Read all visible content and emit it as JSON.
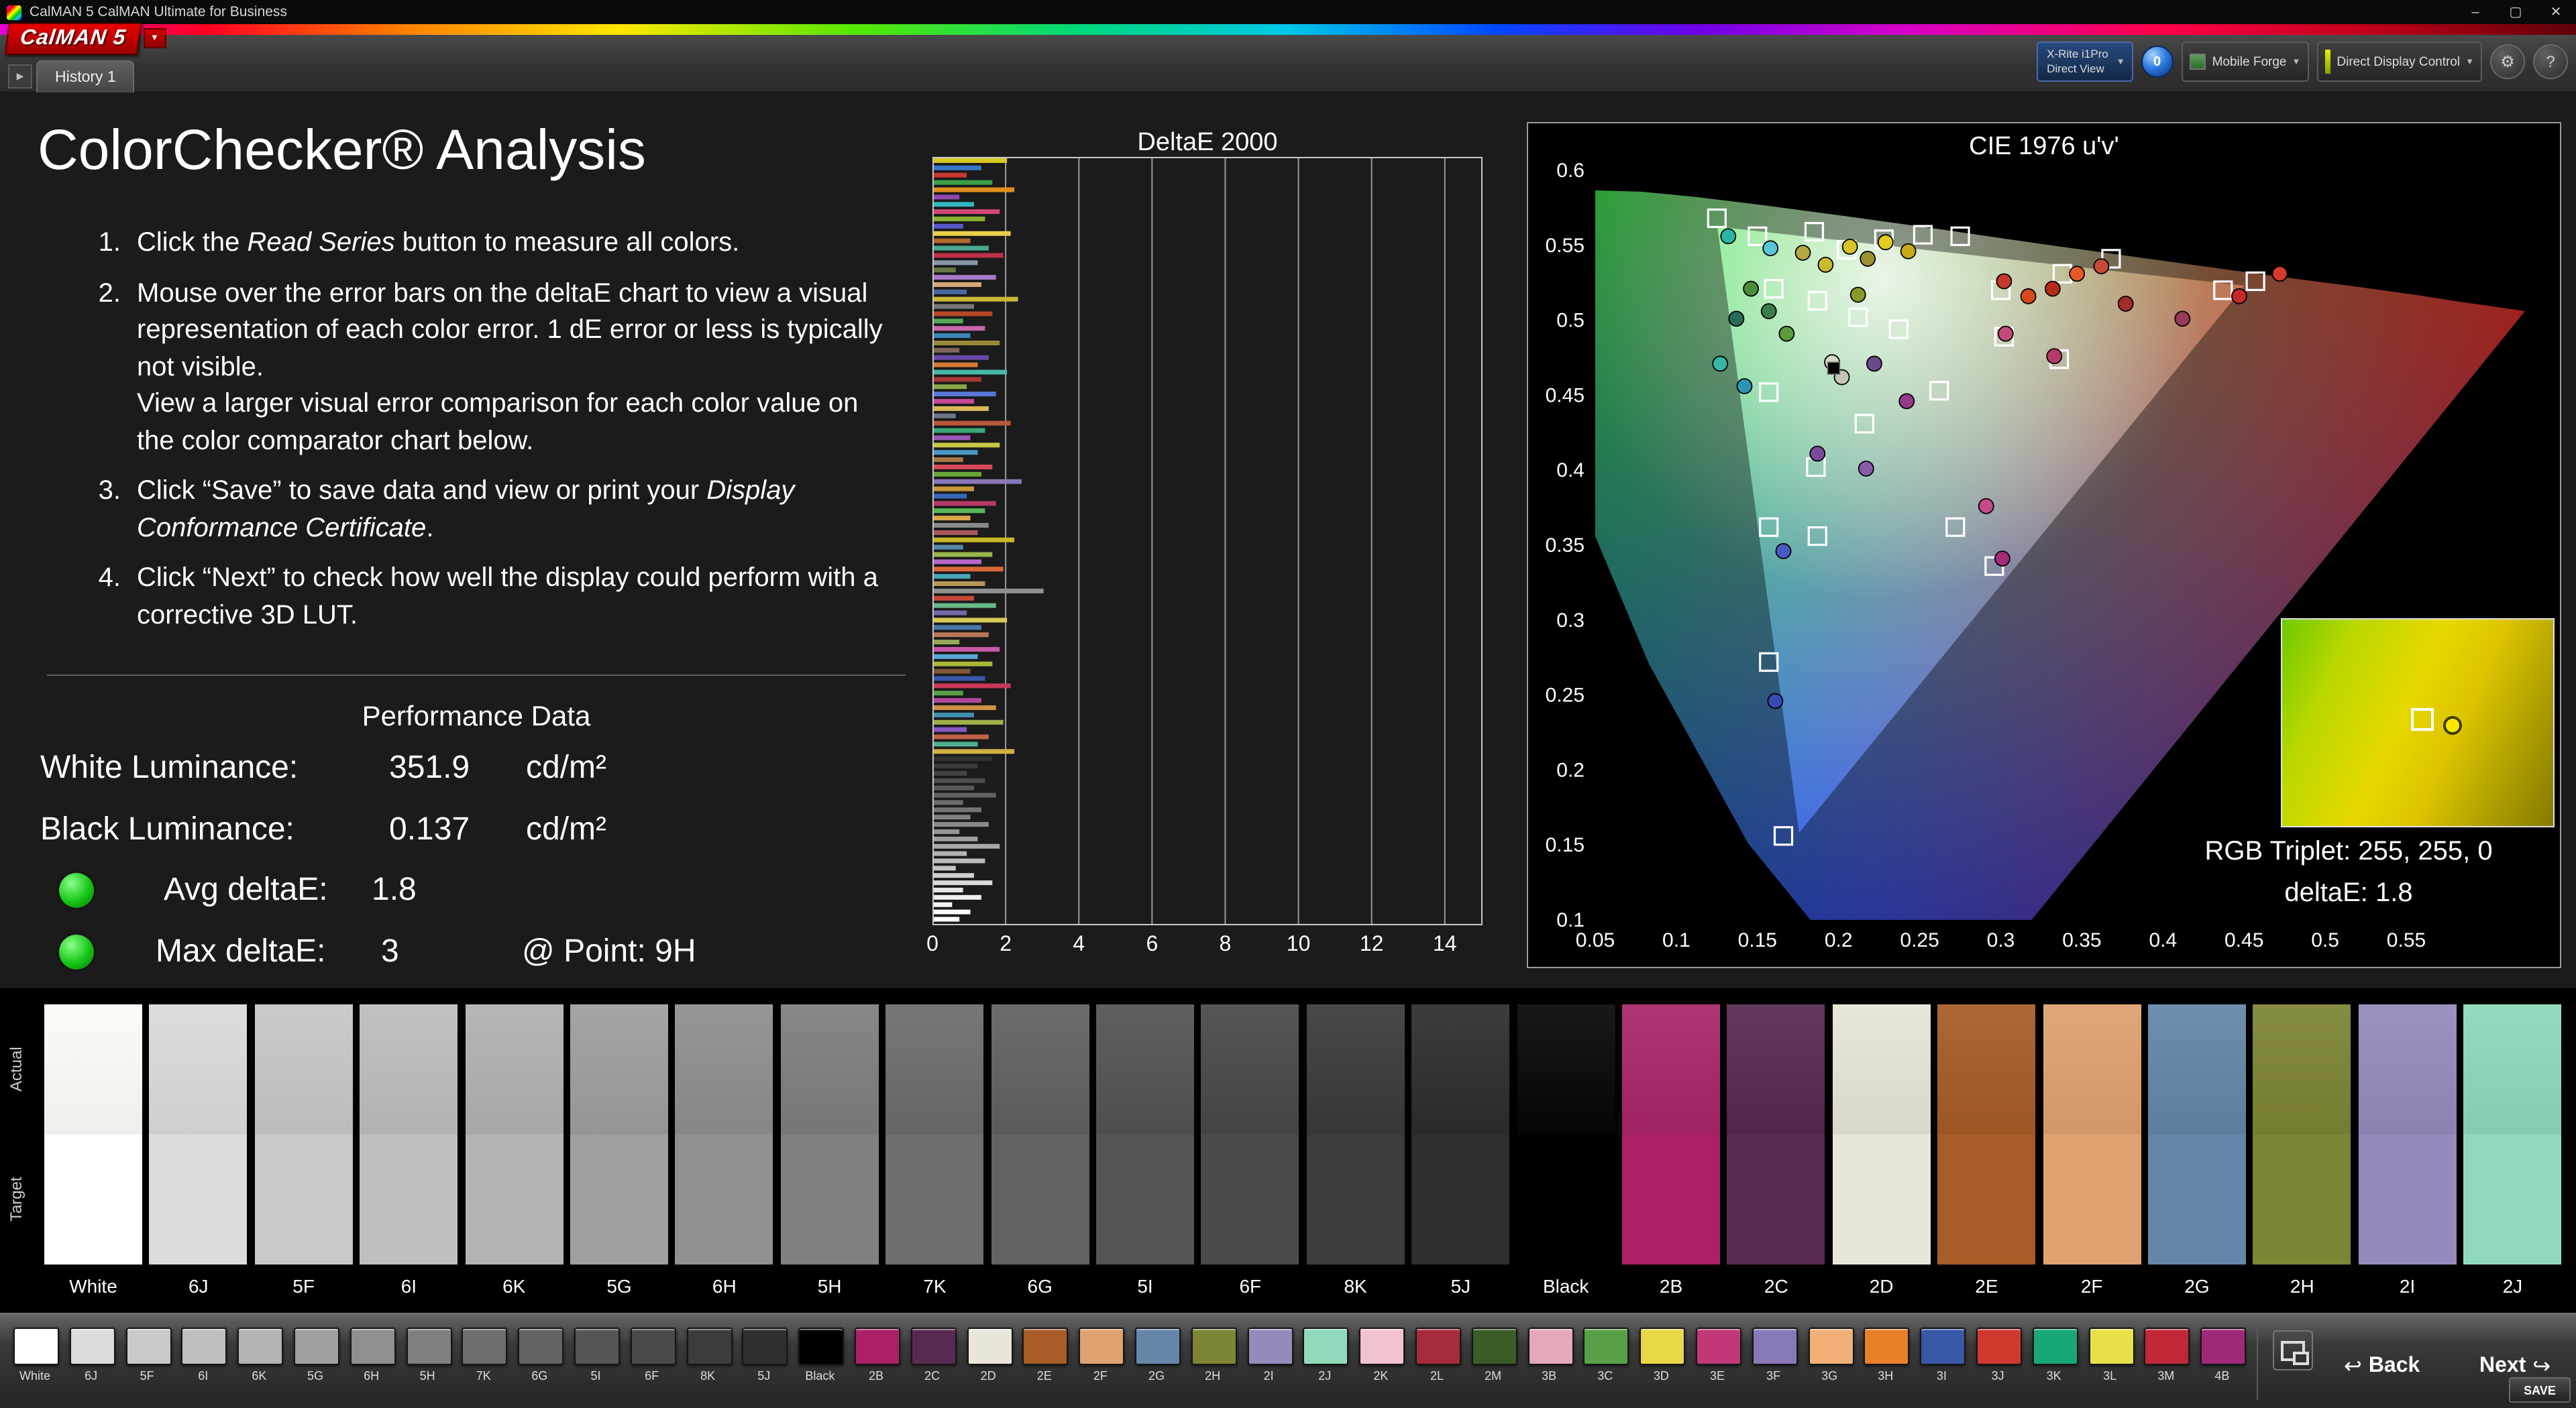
{
  "window": {
    "title": "CalMAN 5 CalMAN Ultimate for Business"
  },
  "icons": {
    "minimize": "–",
    "maximize": "▢",
    "close": "✕",
    "dropdown": "▼",
    "play": "▶",
    "gear": "⚙",
    "help": "?",
    "back": "↩",
    "next": "↪"
  },
  "logo": {
    "text": "CalMAN 5",
    "caret": "▼"
  },
  "tabbar": {
    "history_tab": "History 1"
  },
  "controls": {
    "meter_line1": "X-Rite i1Pro",
    "meter_line2": "Direct View",
    "meter_count": "0",
    "source_label": "Mobile Forge",
    "ddc_label": "Direct Display Control"
  },
  "page": {
    "title": "ColorChecker® Analysis",
    "instructions": [
      {
        "num": "1.",
        "segments": [
          {
            "t": "Click the ",
            "i": false
          },
          {
            "t": "Read Series",
            "i": true
          },
          {
            "t": " button to measure all colors.",
            "i": false
          }
        ]
      },
      {
        "num": "2.",
        "segments": [
          {
            "t": "Mouse over the error bars on the deltaE chart to view a visual representation of each color error. 1 dE error or less is typically not visible.\nView a larger visual error comparison for each color value on the color comparator chart below.",
            "i": false
          }
        ]
      },
      {
        "num": "3.",
        "segments": [
          {
            "t": "Click “Save” to save data and view or print your ",
            "i": false
          },
          {
            "t": "Display Conformance Certificate",
            "i": true
          },
          {
            "t": ".",
            "i": false
          }
        ]
      },
      {
        "num": "4.",
        "segments": [
          {
            "t": "Click “Next” to check how well the display could perform with a corrective 3D LUT.",
            "i": false
          }
        ]
      }
    ]
  },
  "performance": {
    "heading": "Performance Data",
    "rows": [
      {
        "label": "White Luminance:",
        "value": "351.9",
        "unit": "cd/m²",
        "dot": false
      },
      {
        "label": "Black Luminance:",
        "value": "0.137",
        "unit": "cd/m²",
        "dot": false
      },
      {
        "label": "Avg deltaE:",
        "value": "1.8",
        "unit": "",
        "dot": true
      },
      {
        "label": "Max deltaE:",
        "value": "3",
        "unit": "@ Point: 9H",
        "dot": true
      }
    ]
  },
  "chart_data": [
    {
      "type": "bar",
      "title": "DeltaE 2000",
      "orientation": "horizontal",
      "xlabel": "deltaE 2000",
      "xlim": [
        0,
        14
      ],
      "x_ticks": [
        0,
        2,
        4,
        6,
        8,
        10,
        12,
        14
      ],
      "grid": true,
      "bars": [
        [
          2.0,
          "#d8c820"
        ],
        [
          1.3,
          "#3878c8"
        ],
        [
          0.9,
          "#c83830"
        ],
        [
          1.6,
          "#38a048"
        ],
        [
          2.2,
          "#e09020"
        ],
        [
          0.7,
          "#9048b0"
        ],
        [
          1.1,
          "#30b8c0"
        ],
        [
          1.8,
          "#d04878"
        ],
        [
          1.4,
          "#88b030"
        ],
        [
          0.8,
          "#5858c8"
        ],
        [
          2.1,
          "#e8d048"
        ],
        [
          1.0,
          "#b06828"
        ],
        [
          1.5,
          "#48a890"
        ],
        [
          1.9,
          "#c03048"
        ],
        [
          1.2,
          "#8898a8"
        ],
        [
          0.6,
          "#687848"
        ],
        [
          1.7,
          "#a878c8"
        ],
        [
          1.3,
          "#d8a878"
        ],
        [
          0.9,
          "#4868a0"
        ],
        [
          2.3,
          "#c8b838"
        ],
        [
          1.1,
          "#787878"
        ],
        [
          1.6,
          "#b84828"
        ],
        [
          0.8,
          "#58a858"
        ],
        [
          1.4,
          "#c868a8"
        ],
        [
          1.0,
          "#3888b8"
        ],
        [
          1.8,
          "#988838"
        ],
        [
          0.7,
          "#806858"
        ],
        [
          1.5,
          "#6848a8"
        ],
        [
          1.2,
          "#d87838"
        ],
        [
          2.0,
          "#48b8a8"
        ],
        [
          1.3,
          "#a83838"
        ],
        [
          0.9,
          "#88a848"
        ],
        [
          1.7,
          "#5878d8"
        ],
        [
          1.1,
          "#c84898"
        ],
        [
          1.5,
          "#d8b858"
        ],
        [
          0.6,
          "#687888"
        ],
        [
          2.1,
          "#b85838"
        ],
        [
          1.4,
          "#38a878"
        ],
        [
          1.0,
          "#9858b8"
        ],
        [
          1.8,
          "#c8c848"
        ],
        [
          1.2,
          "#4898c8"
        ],
        [
          0.8,
          "#a87848"
        ],
        [
          1.6,
          "#d84858"
        ],
        [
          1.3,
          "#68a838"
        ],
        [
          2.4,
          "#8878b8"
        ],
        [
          1.1,
          "#c89838"
        ],
        [
          0.9,
          "#3868b8"
        ],
        [
          1.7,
          "#b83868"
        ],
        [
          1.4,
          "#58b858"
        ],
        [
          1.0,
          "#d8a848"
        ],
        [
          1.5,
          "#888888"
        ],
        [
          1.2,
          "#a85858"
        ],
        [
          2.2,
          "#c8b828"
        ],
        [
          0.8,
          "#5888a8"
        ],
        [
          1.6,
          "#98b848"
        ],
        [
          1.3,
          "#b868c8"
        ],
        [
          1.9,
          "#d86838"
        ],
        [
          1.0,
          "#48a8b8"
        ],
        [
          1.4,
          "#b89858"
        ],
        [
          3.0,
          "#909090"
        ],
        [
          1.1,
          "#c84838"
        ],
        [
          1.7,
          "#68b888"
        ],
        [
          0.9,
          "#7868a8"
        ],
        [
          2.0,
          "#d8c858"
        ],
        [
          1.3,
          "#4878a8"
        ],
        [
          1.5,
          "#b87858"
        ],
        [
          0.7,
          "#98a858"
        ],
        [
          1.8,
          "#c858a8"
        ],
        [
          1.2,
          "#58a8d8"
        ],
        [
          1.6,
          "#a8b838"
        ],
        [
          1.0,
          "#805838"
        ],
        [
          1.4,
          "#3858a8"
        ],
        [
          2.1,
          "#c83858"
        ],
        [
          0.8,
          "#58a048"
        ],
        [
          1.3,
          "#b04898"
        ],
        [
          1.7,
          "#d09048"
        ],
        [
          1.1,
          "#4090b0"
        ],
        [
          1.9,
          "#a0b048"
        ],
        [
          0.9,
          "#8858c0"
        ],
        [
          1.5,
          "#c06048"
        ],
        [
          1.2,
          "#50b090"
        ],
        [
          2.2,
          "#d0b040"
        ],
        [
          1.6,
          "#303030"
        ],
        [
          1.2,
          "#3a3a3a"
        ],
        [
          0.9,
          "#444444"
        ],
        [
          1.4,
          "#4e4e4e"
        ],
        [
          1.1,
          "#585858"
        ],
        [
          1.7,
          "#626262"
        ],
        [
          0.8,
          "#6c6c6c"
        ],
        [
          1.3,
          "#767676"
        ],
        [
          1.0,
          "#808080"
        ],
        [
          1.5,
          "#8a8a8a"
        ],
        [
          0.7,
          "#949494"
        ],
        [
          1.2,
          "#9e9e9e"
        ],
        [
          1.8,
          "#a8a8a8"
        ],
        [
          0.9,
          "#b2b2b2"
        ],
        [
          1.4,
          "#bcbcbc"
        ],
        [
          0.6,
          "#c6c6c6"
        ],
        [
          1.1,
          "#d0d0d0"
        ],
        [
          1.6,
          "#dadada"
        ],
        [
          0.8,
          "#e4e4e4"
        ],
        [
          1.3,
          "#eeeeee"
        ],
        [
          0.5,
          "#f4f4f4"
        ],
        [
          1.0,
          "#fafafa"
        ],
        [
          0.7,
          "#ffffff"
        ]
      ]
    },
    {
      "type": "scatter",
      "title": "CIE 1976 u'v'",
      "xlim": [
        0.05,
        0.55
      ],
      "ylim": [
        0.1,
        0.6
      ],
      "x_tick_labels": [
        "0.05",
        "0.1",
        "0.15",
        "0.2",
        "0.25",
        "0.3",
        "0.35",
        "0.4",
        "0.45",
        "0.5",
        "0.55"
      ],
      "y_tick_labels": [
        "0.6",
        "0.55",
        "0.5",
        "0.45",
        "0.4",
        "0.35",
        "0.3",
        "0.25",
        "0.2",
        "0.15",
        "0.1"
      ],
      "target_squares": [
        [
          0.125,
          0.568
        ],
        [
          0.15,
          0.556
        ],
        [
          0.185,
          0.559
        ],
        [
          0.205,
          0.547
        ],
        [
          0.228,
          0.554
        ],
        [
          0.252,
          0.557
        ],
        [
          0.275,
          0.556
        ],
        [
          0.16,
          0.521
        ],
        [
          0.187,
          0.513
        ],
        [
          0.212,
          0.502
        ],
        [
          0.237,
          0.494
        ],
        [
          0.3,
          0.52
        ],
        [
          0.338,
          0.531
        ],
        [
          0.368,
          0.541
        ],
        [
          0.302,
          0.489
        ],
        [
          0.336,
          0.474
        ],
        [
          0.262,
          0.453
        ],
        [
          0.216,
          0.431
        ],
        [
          0.157,
          0.452
        ],
        [
          0.186,
          0.402
        ],
        [
          0.157,
          0.362
        ],
        [
          0.187,
          0.356
        ],
        [
          0.272,
          0.362
        ],
        [
          0.296,
          0.336
        ],
        [
          0.157,
          0.272
        ],
        [
          0.166,
          0.156
        ],
        [
          0.437,
          0.52
        ],
        [
          0.457,
          0.526
        ]
      ],
      "measured_points": [
        [
          0.132,
          0.556,
          "#2ab5a5"
        ],
        [
          0.158,
          0.548,
          "#59c5d5"
        ],
        [
          0.178,
          0.545,
          "#b5a642"
        ],
        [
          0.192,
          0.537,
          "#c9b930"
        ],
        [
          0.207,
          0.549,
          "#d5c32a"
        ],
        [
          0.218,
          0.541,
          "#9b902e"
        ],
        [
          0.229,
          0.552,
          "#e1cd20"
        ],
        [
          0.243,
          0.546,
          "#c9a918"
        ],
        [
          0.146,
          0.521,
          "#4a8c3a"
        ],
        [
          0.157,
          0.506,
          "#3a7c4a"
        ],
        [
          0.168,
          0.491,
          "#5a9c3a"
        ],
        [
          0.137,
          0.501,
          "#2a6c5a"
        ],
        [
          0.127,
          0.471,
          "#3ab5a5"
        ],
        [
          0.142,
          0.456,
          "#2a95b5"
        ],
        [
          0.302,
          0.526,
          "#c53a2a"
        ],
        [
          0.317,
          0.516,
          "#d54a1a"
        ],
        [
          0.332,
          0.521,
          "#b52a1a"
        ],
        [
          0.347,
          0.531,
          "#e55a2a"
        ],
        [
          0.362,
          0.536,
          "#c54a3a"
        ],
        [
          0.377,
          0.511,
          "#a52a2a"
        ],
        [
          0.412,
          0.501,
          "#953a5a"
        ],
        [
          0.447,
          0.516,
          "#c52a2a"
        ],
        [
          0.472,
          0.531,
          "#d53a2a"
        ],
        [
          0.303,
          0.491,
          "#c54a7a"
        ],
        [
          0.333,
          0.476,
          "#b53a6a"
        ],
        [
          0.291,
          0.376,
          "#c54a8a"
        ],
        [
          0.301,
          0.341,
          "#a52a7a"
        ],
        [
          0.242,
          0.446,
          "#953a8a"
        ],
        [
          0.187,
          0.411,
          "#7a4a9a"
        ],
        [
          0.217,
          0.401,
          "#8a5aaa"
        ],
        [
          0.222,
          0.471,
          "#6a4a8a"
        ],
        [
          0.161,
          0.246,
          "#3a4ab5"
        ],
        [
          0.166,
          0.346,
          "#4a5ac5"
        ],
        [
          0.196,
          0.472,
          "#d5d5c5"
        ],
        [
          0.202,
          0.462,
          "#c5c5b5"
        ],
        [
          0.212,
          0.517,
          "#8a9a2a"
        ]
      ],
      "white_point": [
        0.197,
        0.468
      ],
      "readout": {
        "line1": "RGB Triplet: 255, 255, 0",
        "line2": "deltaE: 1.8"
      }
    }
  ],
  "swatch_rows": {
    "row_labels": [
      "Actual",
      "Target"
    ],
    "items": [
      {
        "label": "White",
        "actual": "#fbfbf8",
        "target": "#ffffff"
      },
      {
        "label": "6J",
        "actual": "#dadada",
        "target": "#dcdcdc"
      },
      {
        "label": "5F",
        "actual": "#c6c6c6",
        "target": "#c9c9c9"
      },
      {
        "label": "6I",
        "actual": "#bcbcbc",
        "target": "#bfbfbf"
      },
      {
        "label": "6K",
        "actual": "#b0b0b0",
        "target": "#b3b3b3"
      },
      {
        "label": "5G",
        "actual": "#9d9d9d",
        "target": "#a0a0a0"
      },
      {
        "label": "6H",
        "actual": "#8d8d8d",
        "target": "#909090"
      },
      {
        "label": "5H",
        "actual": "#7d7d7d",
        "target": "#808080"
      },
      {
        "label": "7K",
        "actual": "#6b6b6b",
        "target": "#6e6e6e"
      },
      {
        "label": "6G",
        "actual": "#606060",
        "target": "#636363"
      },
      {
        "label": "5I",
        "actual": "#525252",
        "target": "#555555"
      },
      {
        "label": "6F",
        "actual": "#474747",
        "target": "#4a4a4a"
      },
      {
        "label": "8K",
        "actual": "#393939",
        "target": "#3c3c3c"
      },
      {
        "label": "5J",
        "actual": "#2c2c2c",
        "target": "#2f2f2f"
      },
      {
        "label": "Black",
        "actual": "#050505",
        "target": "#000000"
      },
      {
        "label": "2B",
        "actual": "#a82468",
        "target": "#ab2066"
      },
      {
        "label": "2C",
        "actual": "#55284f",
        "target": "#582a52"
      },
      {
        "label": "2D",
        "actual": "#e7e3d6",
        "target": "#eae6d9"
      },
      {
        "label": "2E",
        "actual": "#a55a26",
        "target": "#a85c28"
      },
      {
        "label": "2F",
        "actual": "#dd9f6e",
        "target": "#e0a270"
      },
      {
        "label": "2G",
        "actual": "#6384a6",
        "target": "#6586a9"
      },
      {
        "label": "2H",
        "actual": "#7c8232",
        "target": "#7e8534"
      },
      {
        "label": "2I",
        "actual": "#9488bb",
        "target": "#968abd"
      },
      {
        "label": "2J",
        "actual": "#8dd7b8",
        "target": "#90dabb"
      }
    ]
  },
  "toolbar": {
    "swatches": [
      {
        "label": "White",
        "color": "#ffffff"
      },
      {
        "label": "6J",
        "color": "#dcdcdc"
      },
      {
        "label": "5F",
        "color": "#c9c9c9"
      },
      {
        "label": "6I",
        "color": "#bfbfbf"
      },
      {
        "label": "6K",
        "color": "#b3b3b3"
      },
      {
        "label": "5G",
        "color": "#a0a0a0"
      },
      {
        "label": "6H",
        "color": "#909090"
      },
      {
        "label": "5H",
        "color": "#808080"
      },
      {
        "label": "7K",
        "color": "#6e6e6e"
      },
      {
        "label": "6G",
        "color": "#636363"
      },
      {
        "label": "5I",
        "color": "#555555"
      },
      {
        "label": "6F",
        "color": "#4a4a4a"
      },
      {
        "label": "8K",
        "color": "#3c3c3c"
      },
      {
        "label": "5J",
        "color": "#2f2f2f"
      },
      {
        "label": "Black",
        "color": "#000000"
      },
      {
        "label": "2B",
        "color": "#ab2066"
      },
      {
        "label": "2C",
        "color": "#582a52"
      },
      {
        "label": "2D",
        "color": "#eae6d9"
      },
      {
        "label": "2E",
        "color": "#a85c28"
      },
      {
        "label": "2F",
        "color": "#e0a270"
      },
      {
        "label": "2G",
        "color": "#6586a9"
      },
      {
        "label": "2H",
        "color": "#7e8534"
      },
      {
        "label": "2I",
        "color": "#968abd"
      },
      {
        "label": "2J",
        "color": "#90dabb"
      },
      {
        "label": "2K",
        "color": "#f2c3ce"
      },
      {
        "label": "2L",
        "color": "#a62c3c"
      },
      {
        "label": "2M",
        "color": "#3c5c28"
      },
      {
        "label": "3B",
        "color": "#e4a8b8"
      },
      {
        "label": "3C",
        "color": "#58a048"
      },
      {
        "label": "3D",
        "color": "#e8d848"
      },
      {
        "label": "3E",
        "color": "#c03878"
      },
      {
        "label": "3F",
        "color": "#8878b8"
      },
      {
        "label": "3G",
        "color": "#f0b078"
      },
      {
        "label": "3H",
        "color": "#e88028"
      },
      {
        "label": "3I",
        "color": "#3858a8"
      },
      {
        "label": "3J",
        "color": "#d03830"
      },
      {
        "label": "3K",
        "color": "#18a878"
      },
      {
        "label": "3L",
        "color": "#e8e048"
      },
      {
        "label": "3M",
        "color": "#c02838"
      },
      {
        "label": "4B",
        "color": "#a02878"
      }
    ],
    "back_label": "Back",
    "next_label": "Next",
    "save_label": "SAVE"
  }
}
